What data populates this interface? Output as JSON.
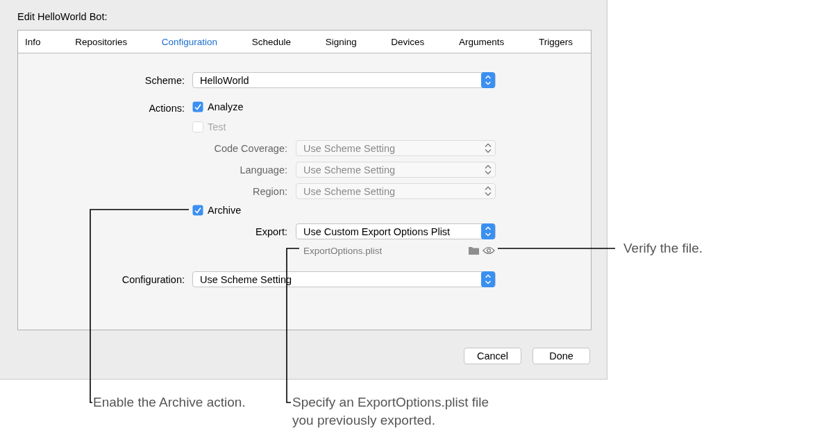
{
  "dialog": {
    "title": "Edit HelloWorld Bot:",
    "tabs": [
      {
        "label": "Info",
        "selected": false
      },
      {
        "label": "Repositories",
        "selected": false
      },
      {
        "label": "Configuration",
        "selected": true
      },
      {
        "label": "Schedule",
        "selected": false
      },
      {
        "label": "Signing",
        "selected": false
      },
      {
        "label": "Devices",
        "selected": false
      },
      {
        "label": "Arguments",
        "selected": false
      },
      {
        "label": "Triggers",
        "selected": false
      }
    ],
    "scheme": {
      "label": "Scheme:",
      "value": "HelloWorld"
    },
    "actions": {
      "label": "Actions:",
      "items": [
        {
          "label": "Analyze",
          "checked": true,
          "disabled": false
        },
        {
          "label": "Test",
          "checked": false,
          "disabled": true,
          "settings": [
            {
              "label": "Code Coverage:",
              "value": "Use Scheme Setting"
            },
            {
              "label": "Language:",
              "value": "Use Scheme Setting"
            },
            {
              "label": "Region:",
              "value": "Use Scheme Setting"
            }
          ]
        },
        {
          "label": "Archive",
          "checked": true,
          "disabled": false,
          "settings": [
            {
              "label": "Export:",
              "value": "Use Custom Export Options Plist"
            }
          ],
          "file": "ExportOptions.plist"
        }
      ]
    },
    "configuration": {
      "label": "Configuration:",
      "value": "Use Scheme Setting"
    },
    "buttons": [
      "Cancel",
      "Done"
    ]
  },
  "callouts": [
    {
      "text": "Enable the Archive action."
    },
    {
      "text": "Specify an ExportOptions.plist file you previously exported."
    },
    {
      "text": "Verify the file."
    }
  ]
}
